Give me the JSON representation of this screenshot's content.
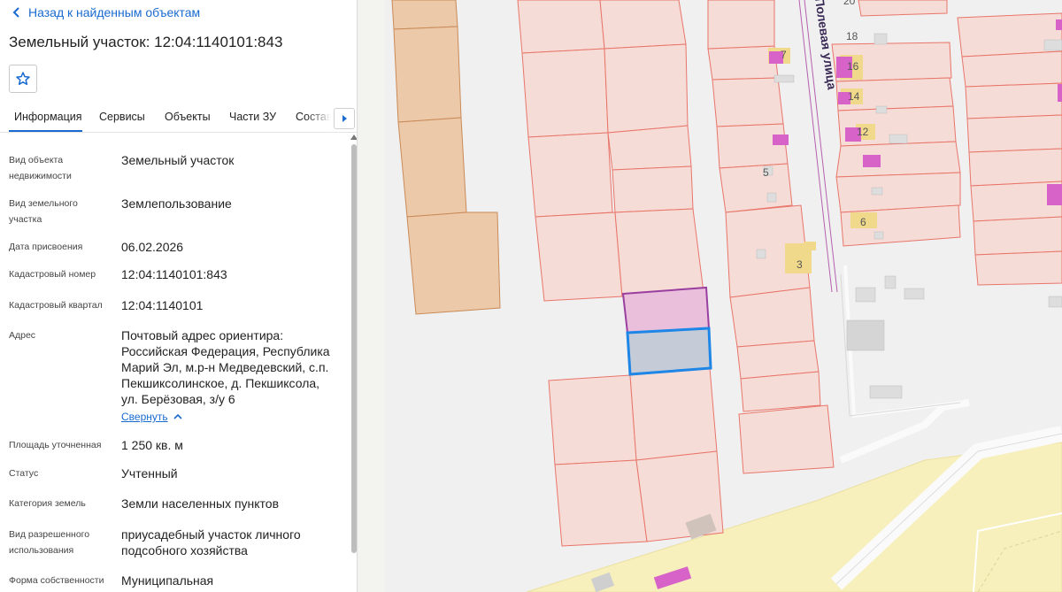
{
  "panel": {
    "back_label": "Назад к найденным объектам",
    "title": "Земельный участок: 12:04:1140101:843",
    "tabs": [
      "Информация",
      "Сервисы",
      "Объекты",
      "Части ЗУ",
      "Состав"
    ],
    "active_tab": "Информация",
    "fields": [
      {
        "label": "Вид объекта недвижимости",
        "value": "Земельный участок"
      },
      {
        "label": "Вид земельного участка",
        "value": "Землепользование"
      },
      {
        "label": "Дата присвоения",
        "value": "06.02.2026"
      },
      {
        "label": "Кадастровый номер",
        "value": "12:04:1140101:843"
      },
      {
        "label": "Кадастровый квартал",
        "value": "12:04:1140101"
      },
      {
        "label": "Адрес",
        "value": "Почтовый адрес ориентира: Российская Федерация, Республика Марий Эл, м.р-н Медведевский, с.п. Пекшиксолинское, д. Пекшиксола, ул. Берёзовая, з/у 6"
      },
      {
        "label": "Площадь уточненная",
        "value": "1 250 кв. м"
      },
      {
        "label": "Статус",
        "value": "Учтенный"
      },
      {
        "label": "Категория земель",
        "value": "Земли населенных пунктов"
      },
      {
        "label": "Вид разрешенного использования",
        "value": "приусадебный участок личного подсобного хозяйства"
      },
      {
        "label": "Форма собственности",
        "value": "Муниципальная"
      }
    ],
    "collapse_label": "Свернуть"
  },
  "map": {
    "street_label": "Полевая улица",
    "house_numbers": [
      "20",
      "18",
      "7",
      "16",
      "14",
      "12",
      "5",
      "6",
      "3"
    ],
    "colors": {
      "parcel_fill": "#f6dcd6",
      "parcel_stroke": "#e8756a",
      "orange_fill": "#ecc9a8",
      "orange_stroke": "#c98a58",
      "selected_stroke": "#1d86e6",
      "selected_fill": "#c6cbd8",
      "highlight_fill": "#e9bfdc",
      "highlight_stroke": "#9a3fa0",
      "building_magenta": "#d763c8",
      "building_yellow": "#f0d98a",
      "yellow_zone": "#f7efbc",
      "accent": "#1a6bd0"
    }
  }
}
